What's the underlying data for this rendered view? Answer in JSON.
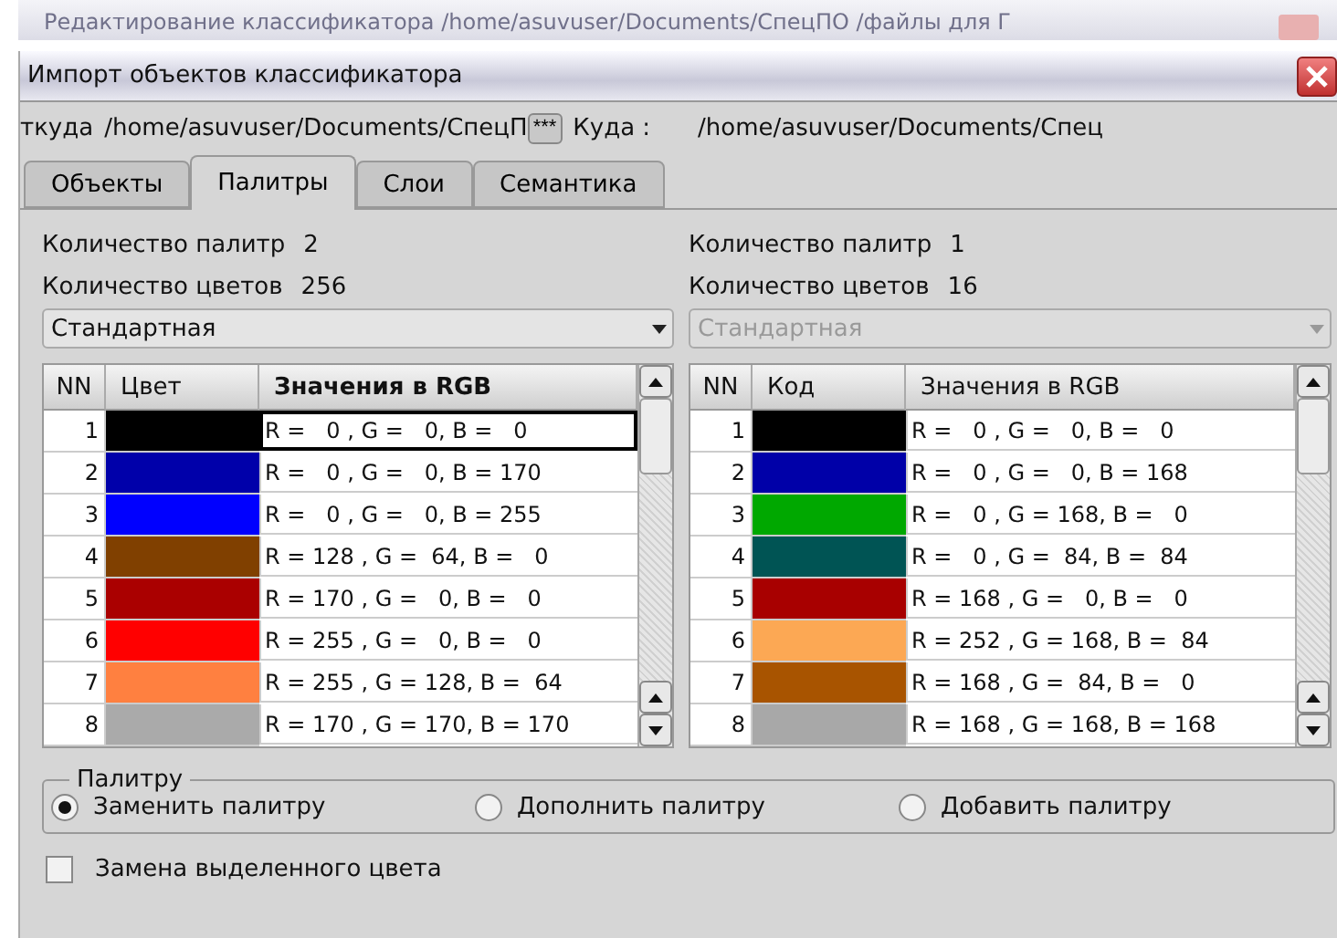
{
  "background_window": {
    "title": "Редактирование классификатора /home/asuvuser/Documents/СпецПО /файлы для Г"
  },
  "window": {
    "title": "Импорт объектов классификатора"
  },
  "paths": {
    "source_label": "ткуда",
    "source_path": "/home/asuvuser/Documents/СпецП",
    "browse_button": "***",
    "target_label": "Куда :",
    "target_path": "/home/asuvuser/Documents/Спец"
  },
  "tabs": [
    {
      "label": "Объекты",
      "selected": false
    },
    {
      "label": "Палитры",
      "selected": true
    },
    {
      "label": "Слои",
      "selected": false
    },
    {
      "label": "Семантика",
      "selected": false
    }
  ],
  "palettes": [
    {
      "palette_count_label": "Количество палитр",
      "palette_count": "2",
      "color_count_label": "Количество цветов",
      "color_count": "256",
      "dropdown": {
        "value": "Стандартная",
        "disabled": false
      },
      "active": true,
      "columns": [
        "NN",
        "Цвет",
        "Значения в RGB"
      ],
      "rows": [
        {
          "nn": "1",
          "color": "#000000",
          "rgb": "R =   0 , G =   0, B =   0",
          "selected": true
        },
        {
          "nn": "2",
          "color": "#0000aa",
          "rgb": "R =   0 , G =   0, B = 170",
          "selected": false
        },
        {
          "nn": "3",
          "color": "#0000ff",
          "rgb": "R =   0 , G =   0, B = 255",
          "selected": false
        },
        {
          "nn": "4",
          "color": "#804000",
          "rgb": "R = 128 , G =  64, B =   0",
          "selected": false
        },
        {
          "nn": "5",
          "color": "#aa0000",
          "rgb": "R = 170 , G =   0, B =   0",
          "selected": false
        },
        {
          "nn": "6",
          "color": "#ff0000",
          "rgb": "R = 255 , G =   0, B =   0",
          "selected": false
        },
        {
          "nn": "7",
          "color": "#ff8040",
          "rgb": "R = 255 , G = 128, B =  64",
          "selected": false
        },
        {
          "nn": "8",
          "color": "#aaaaaa",
          "rgb": "R = 170 , G = 170, B = 170",
          "selected": false
        }
      ]
    },
    {
      "palette_count_label": "Количество палитр",
      "palette_count": "1",
      "color_count_label": "Количество цветов",
      "color_count": "16",
      "dropdown": {
        "value": "Стандартная",
        "disabled": true
      },
      "active": false,
      "columns": [
        "NN",
        "Код",
        "Значения в RGB"
      ],
      "rows": [
        {
          "nn": "1",
          "color": "#000000",
          "rgb": "R =   0 , G =   0, B =   0",
          "selected": false
        },
        {
          "nn": "2",
          "color": "#0000a8",
          "rgb": "R =   0 , G =   0, B = 168",
          "selected": false
        },
        {
          "nn": "3",
          "color": "#00a800",
          "rgb": "R =   0 , G = 168, B =   0",
          "selected": false
        },
        {
          "nn": "4",
          "color": "#005454",
          "rgb": "R =   0 , G =  84, B =  84",
          "selected": false
        },
        {
          "nn": "5",
          "color": "#a80000",
          "rgb": "R = 168 , G =   0, B =   0",
          "selected": false
        },
        {
          "nn": "6",
          "color": "#fca854",
          "rgb": "R = 252 , G = 168, B =  84",
          "selected": false
        },
        {
          "nn": "7",
          "color": "#a85400",
          "rgb": "R = 168 , G =  84, B =   0",
          "selected": false
        },
        {
          "nn": "8",
          "color": "#a8a8a8",
          "rgb": "R = 168 , G = 168, B = 168",
          "selected": false
        }
      ]
    }
  ],
  "palette_group": {
    "title": "Палитру",
    "options": [
      {
        "label": "Заменить палитру",
        "selected": true
      },
      {
        "label": "Дополнить палитру",
        "selected": false
      },
      {
        "label": "Добавить палитру",
        "selected": false
      }
    ]
  },
  "replace_selected": {
    "label": "Замена выделенного цвета",
    "checked": false
  }
}
